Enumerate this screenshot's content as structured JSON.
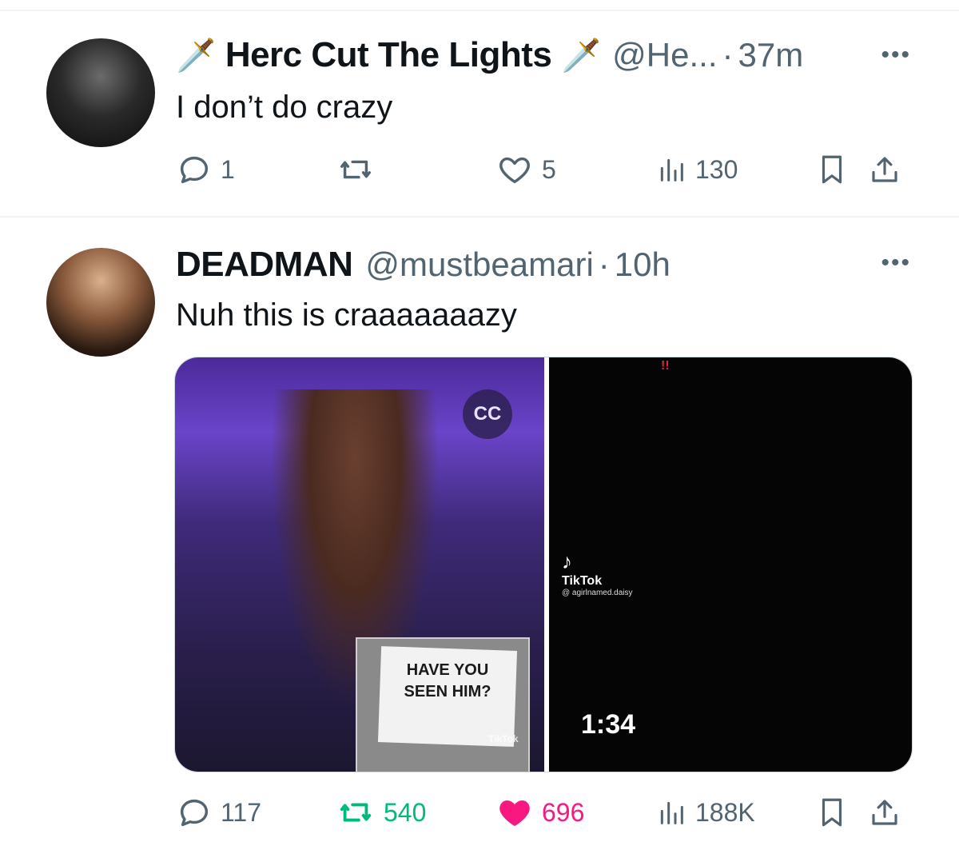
{
  "tweets": [
    {
      "display_name": "Herc Cut The Lights",
      "handle": "@He...",
      "separator": "·",
      "time": "37m",
      "decoration_left": "🗡️",
      "decoration_right": "🗡️",
      "text": "I don’t do crazy",
      "more_icon": "more-horizontal-icon",
      "stats": {
        "replies": "1",
        "reposts": "",
        "likes": "5",
        "views": "130"
      },
      "liked": false
    },
    {
      "display_name": "DEADMAN",
      "handle": "@mustbeamari",
      "separator": "·",
      "time": "10h",
      "text": "Nuh this is craaaaaaazy",
      "more_icon": "more-horizontal-icon",
      "stats": {
        "replies": "117",
        "reposts": "540",
        "likes": "696",
        "views": "188K"
      },
      "liked": true,
      "media": {
        "left": {
          "cc_label": "CC",
          "poster_text": "HAVE YOU SEEN HIM?",
          "tiktok_watermark": "TikTok"
        },
        "right": {
          "rec_badge": "!!",
          "tiktok_label": "TikTok",
          "tiktok_user": "@ agirlnamed.daisy",
          "duration": "1:34"
        }
      }
    }
  ],
  "colors": {
    "muted": "#536471",
    "repost_active": "#00ba7c",
    "like_active": "#f91880",
    "divider": "#eff3f4"
  }
}
